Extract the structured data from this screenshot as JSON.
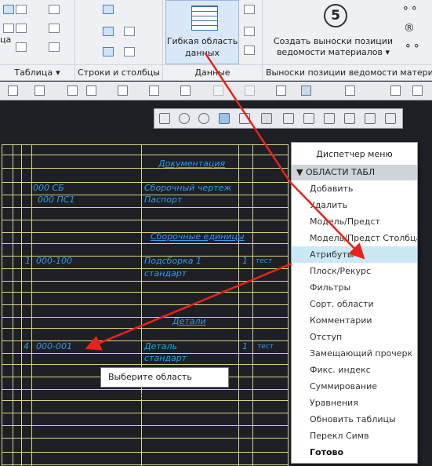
{
  "ribbon": {
    "groups": {
      "table": "Таблица",
      "rows_cols": "Строки и столбцы",
      "data": "Данные",
      "balloons": "Выноски позиции ведомости материалов"
    },
    "flex_area": {
      "line1": "Гибкая область",
      "line2": "данных"
    },
    "create_balloon": {
      "line1": "Создать выноски позиции",
      "line2": "ведомости материалов ▾"
    },
    "balloon_number": "5",
    "side_labels": {
      "tsa": "ца"
    }
  },
  "table_cells": {
    "documentation": "Документация",
    "r1_code": "000 СБ",
    "r1_name": "Сборочный чертеж",
    "r2_code": "000 ПС1",
    "r2_name": "Паспорт",
    "assemblies": "Сборочные единицы",
    "r3_pos": "1",
    "r3_code": "000-100",
    "r3_name1": "Подсборка 1",
    "r3_name2": "стандарт",
    "r3_qty": "1",
    "r3_note": "тест",
    "parts": "Детали",
    "r4_pos": "4",
    "r4_code": "000-001",
    "r4_name1": "Деталь",
    "r4_name2": "стандарт",
    "r4_qty": "1",
    "r4_note": "тест"
  },
  "menu": {
    "title": "Диспетчер меню",
    "section": "ОБЛАСТИ ТАБЛ",
    "items": [
      "Добавить",
      "Удалить",
      "Модель/Предст",
      "Модель/Предст Столбца",
      "Атрибуты",
      "Плоск/Рекурс",
      "Фильтры",
      "Сорт. области",
      "Комментарии",
      "Отступ",
      "Замещающий прочерк",
      "Фикс. индекс",
      "Суммирование",
      "Уравнения",
      "Обновить таблицы",
      "Перекл Симв",
      "Готово"
    ]
  },
  "tooltip": "Выберите область данных."
}
